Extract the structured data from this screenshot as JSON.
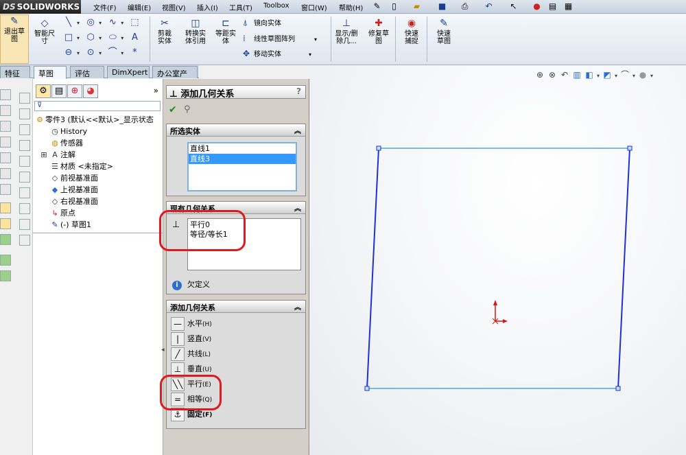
{
  "app": {
    "logo_text": "SOLIDWORKS",
    "logo_mark": "DS"
  },
  "menu": {
    "items": [
      "文件(F)",
      "编辑(E)",
      "视图(V)",
      "插入(I)",
      "工具(T)",
      "Toolbox",
      "窗口(W)",
      "帮助(H)"
    ]
  },
  "ribbon": {
    "exit_sketch": "退出草图",
    "smart_dim": "智能尺寸",
    "trim": "剪裁实体",
    "convert": "转换实体引用",
    "offset": "等距实体",
    "mirror": "镜向实体",
    "linear_pattern": "线性草图阵列",
    "move": "移动实体",
    "show_delete": "显示/删除几...",
    "repair": "修复草图",
    "quick_snap": "快速捕捉",
    "rapid_sketch": "快速草图"
  },
  "tabs": {
    "items": [
      "特征",
      "草图",
      "评估",
      "DimXpert",
      "办公室产品"
    ]
  },
  "feature_tree": {
    "part": "零件3 (默认<<默认>_显示状态",
    "items": [
      "History",
      "传感器",
      "注解",
      "材质 <未指定>",
      "前视基准面",
      "上视基准面",
      "右视基准面",
      "原点",
      "(-) 草图1"
    ]
  },
  "pm": {
    "title": "添加几何关系",
    "help": "?",
    "selected": {
      "header": "所选实体",
      "items": [
        "直线1",
        "直线3"
      ]
    },
    "existing": {
      "header": "现有几何关系",
      "items": [
        "平行0",
        "等径/等长1"
      ],
      "status": "欠定义"
    },
    "add": {
      "header": "添加几何关系",
      "items": [
        {
          "label": "水平",
          "key": "(H)"
        },
        {
          "label": "竖直",
          "key": "(V)"
        },
        {
          "label": "共线",
          "key": "(L)"
        },
        {
          "label": "垂直",
          "key": "(U)"
        },
        {
          "label": "平行",
          "key": "(E)"
        },
        {
          "label": "相等",
          "key": "(Q)"
        },
        {
          "label": "固定",
          "key": "(F)"
        }
      ]
    }
  },
  "colors": {
    "sketch_line": "#1f2fd6",
    "selected_line": "#4aa8e8",
    "annotation": "#e0191f",
    "origin": "#d41818"
  }
}
